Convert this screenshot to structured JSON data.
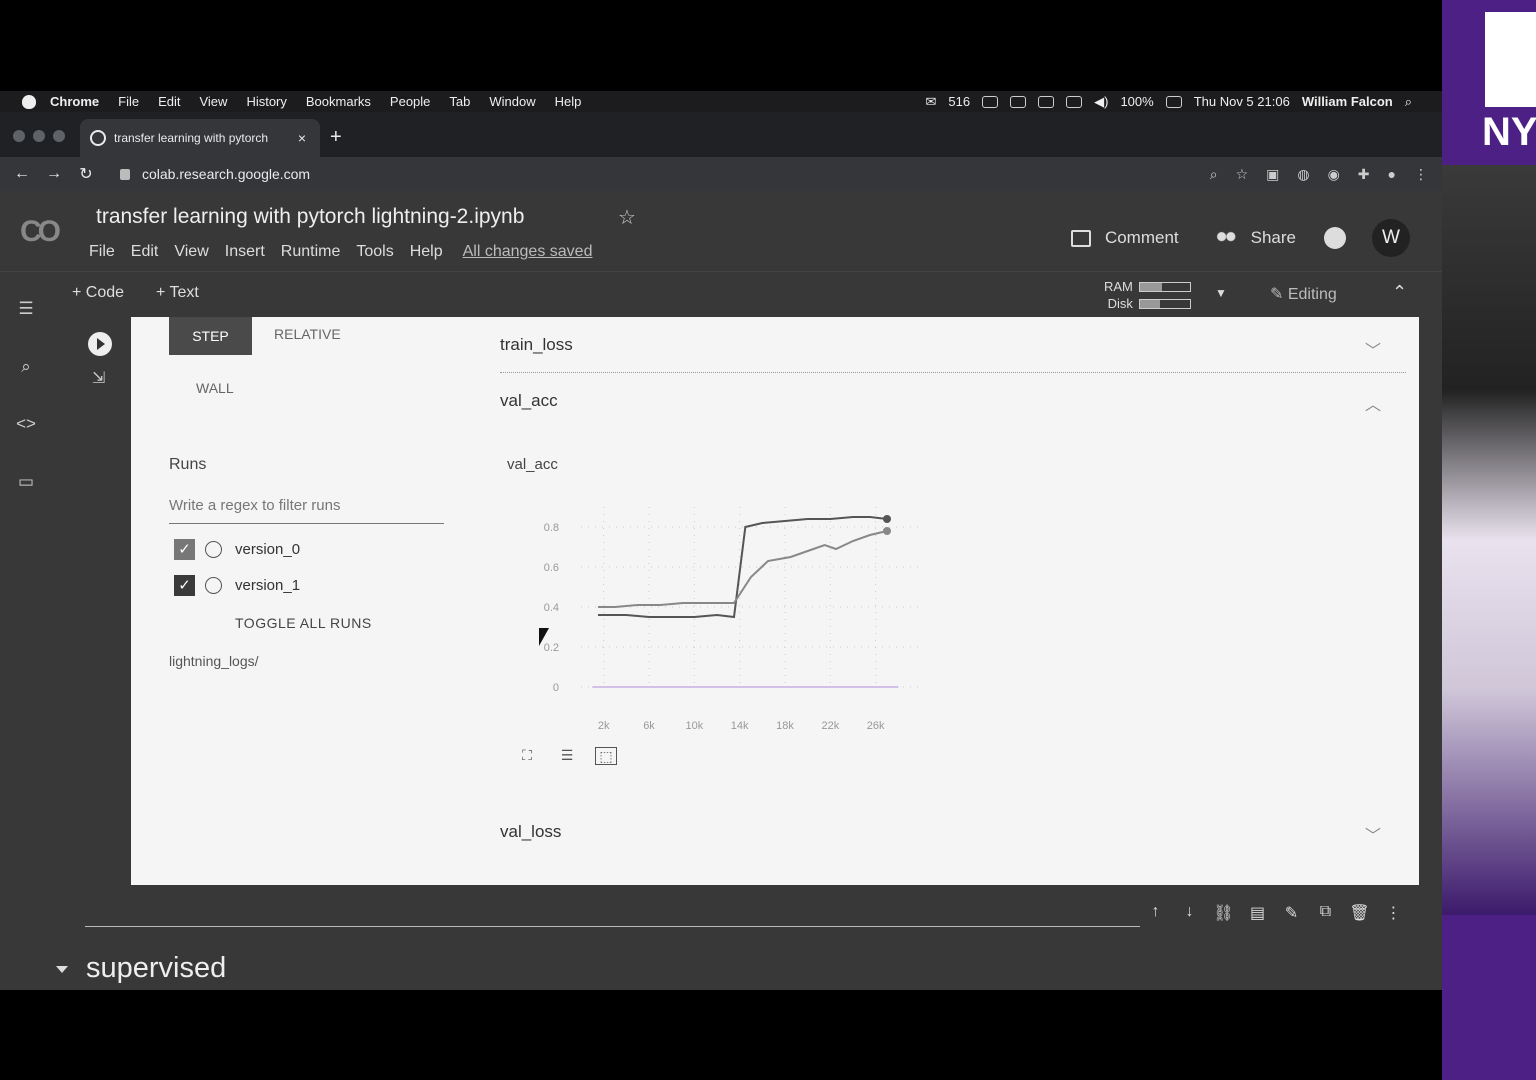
{
  "menubar": {
    "items": [
      "Chrome",
      "File",
      "Edit",
      "View",
      "History",
      "Bookmarks",
      "People",
      "Tab",
      "Window",
      "Help"
    ],
    "mail_count": "516",
    "battery": "100%",
    "clock": "Thu Nov 5  21:06",
    "user": "William Falcon"
  },
  "tab": {
    "title": "transfer learning with pytorch",
    "close": "×",
    "new": "+"
  },
  "address": {
    "url": "colab.research.google.com"
  },
  "colab": {
    "logo": "CO",
    "title": "transfer learning with pytorch lightning-2.ipynb",
    "star": "☆",
    "menu": [
      "File",
      "Edit",
      "View",
      "Insert",
      "Runtime",
      "Tools",
      "Help"
    ],
    "saved": "All changes saved",
    "comment": "Comment",
    "share": "Share",
    "avatar": "W",
    "add_code": "+ Code",
    "add_text": "+ Text",
    "ram": "RAM",
    "disk": "Disk",
    "ram_level": 0.45,
    "disk_level": 0.4,
    "editing": "Editing"
  },
  "tensorboard": {
    "step": "STEP",
    "relative": "RELATIVE",
    "wall": "WALL",
    "runs_heading": "Runs",
    "regex_placeholder": "Write a regex to filter runs",
    "runs": [
      {
        "name": "version_0",
        "checked": true
      },
      {
        "name": "version_1",
        "checked": true
      }
    ],
    "toggle_all": "TOGGLE ALL RUNS",
    "logdir": "lightning_logs/",
    "sections": [
      {
        "title": "train_loss",
        "expanded": false
      },
      {
        "title": "val_acc",
        "expanded": true
      },
      {
        "title": "val_loss",
        "expanded": false
      }
    ],
    "card_title": "val_acc"
  },
  "chart_data": {
    "type": "line",
    "title": "val_acc",
    "x_tick_labels": [
      "2k",
      "6k",
      "10k",
      "14k",
      "18k",
      "22k",
      "26k"
    ],
    "y_tick_labels": [
      "0",
      "0.2",
      "0.4",
      "0.6",
      "0.8"
    ],
    "ylim": [
      0,
      0.9
    ],
    "xlim": [
      0,
      30000
    ],
    "grid": true,
    "series": [
      {
        "color": "#555555",
        "x": [
          1500,
          4000,
          6000,
          8000,
          10000,
          12000,
          13500,
          14500,
          16000,
          18000,
          20000,
          22000,
          24000,
          25500,
          27000
        ],
        "values": [
          0.36,
          0.36,
          0.35,
          0.35,
          0.35,
          0.36,
          0.35,
          0.8,
          0.82,
          0.83,
          0.84,
          0.84,
          0.85,
          0.85,
          0.84
        ]
      },
      {
        "color": "#888888",
        "x": [
          1500,
          3000,
          5000,
          7000,
          9000,
          11000,
          13500,
          15000,
          16500,
          18500,
          20000,
          21500,
          22500,
          24000,
          25500,
          27000
        ],
        "values": [
          0.4,
          0.4,
          0.41,
          0.41,
          0.42,
          0.42,
          0.42,
          0.55,
          0.63,
          0.65,
          0.68,
          0.71,
          0.69,
          0.73,
          0.76,
          0.78
        ]
      },
      {
        "color": "#b48ad8",
        "x": [
          1000,
          28000
        ],
        "values": [
          0,
          0
        ]
      }
    ]
  },
  "cell_toolbar": [
    "↑",
    "↓",
    "⛓",
    "▤",
    "✎",
    "⧉",
    "🗑",
    "⋮"
  ],
  "next_section": "supervised"
}
